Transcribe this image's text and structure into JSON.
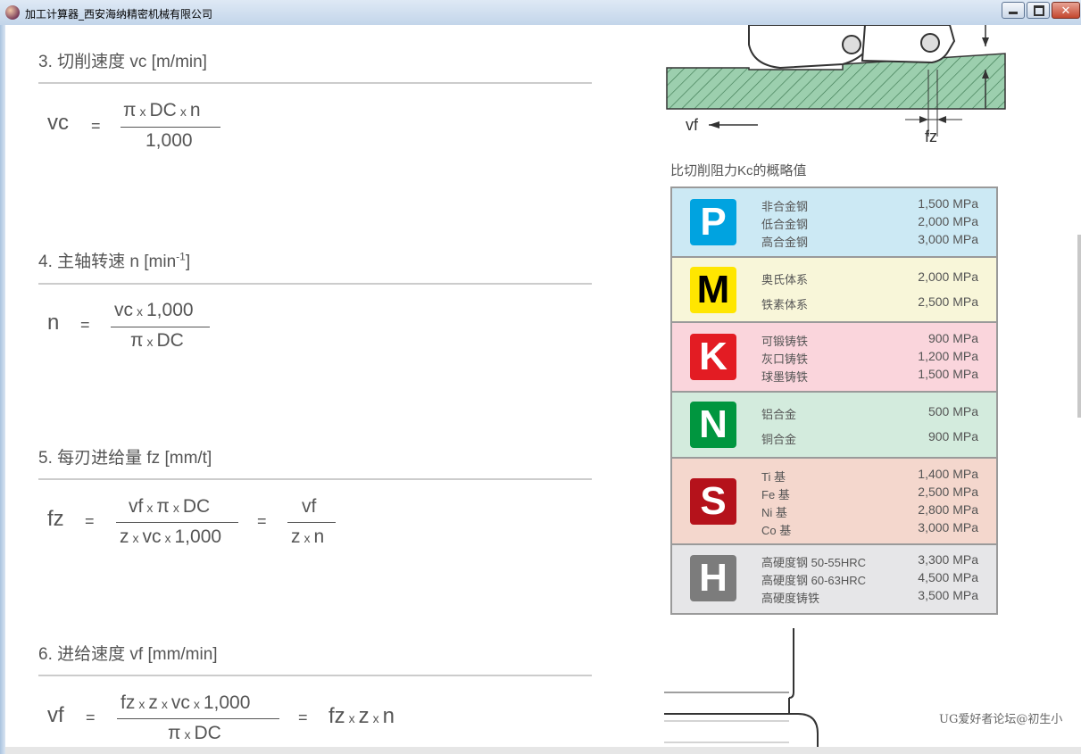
{
  "window": {
    "title": "加工计算器_西安海纳精密机械有限公司"
  },
  "sections": [
    {
      "title": "3. 切削速度 vc [m/min]",
      "var": "vc",
      "fractions": [
        {
          "num": [
            "π",
            "DC",
            "n"
          ],
          "den": [
            "1,000"
          ]
        }
      ]
    },
    {
      "title_main": "4. 主轴转速 n [min",
      "title_sup": "-1",
      "title_end": "]",
      "var": "n",
      "fractions": [
        {
          "num": [
            "vc",
            "1,000"
          ],
          "den": [
            "π",
            "DC"
          ]
        }
      ]
    },
    {
      "title": "5. 每刃进给量 fz [mm/t]",
      "var": "fz",
      "fractions": [
        {
          "num": [
            "vf",
            "π",
            "DC"
          ],
          "den": [
            "z",
            "vc",
            "1,000"
          ]
        },
        {
          "num": [
            "vf"
          ],
          "den": [
            "z",
            "n"
          ]
        }
      ]
    },
    {
      "title": "6. 进给速度 vf [mm/min]",
      "var": "vf",
      "fractions": [
        {
          "num": [
            "fz",
            "z",
            "vc",
            "1,000"
          ],
          "den": [
            "π",
            "DC"
          ]
        }
      ],
      "tail": [
        "fz",
        "z",
        "n"
      ]
    }
  ],
  "eq_sign": "=",
  "times": "x",
  "diagram": {
    "vf_label": "vf",
    "fz_label": "fz"
  },
  "kc_title": "比切削阻力Kc的概略值",
  "kc_table": [
    {
      "letter": "P",
      "bg": "#cce9f4",
      "badge_bg": "#00a3e0",
      "badge_fg": "#ffffff",
      "items": [
        {
          "material": "非合金钢",
          "value": "1,500 MPa"
        },
        {
          "material": "低合金钢",
          "value": "2,000 MPa"
        },
        {
          "material": "高合金钢",
          "value": "3,000 MPa"
        }
      ]
    },
    {
      "letter": "M",
      "bg": "#f8f6d9",
      "badge_bg": "#ffe600",
      "badge_fg": "#000000",
      "items": [
        {
          "material": "奥氏体系",
          "value": "2,000 MPa"
        },
        {
          "material": "铁素体系",
          "value": "2,500 MPa"
        }
      ]
    },
    {
      "letter": "K",
      "bg": "#fad5dc",
      "badge_bg": "#e31c23",
      "badge_fg": "#ffffff",
      "items": [
        {
          "material": "可锻铸铁",
          "value": "900 MPa"
        },
        {
          "material": "灰口铸铁",
          "value": "1,200 MPa"
        },
        {
          "material": "球墨铸铁",
          "value": "1,500 MPa"
        }
      ]
    },
    {
      "letter": "N",
      "bg": "#d3ebdd",
      "badge_bg": "#00963f",
      "badge_fg": "#ffffff",
      "items": [
        {
          "material": "铝合金",
          "value": "500 MPa"
        },
        {
          "material": "铜合金",
          "value": "900 MPa"
        }
      ]
    },
    {
      "letter": "S",
      "bg": "#f4d7cd",
      "badge_bg": "#b5121b",
      "badge_fg": "#ffffff",
      "items": [
        {
          "material": "Ti 基",
          "value": "1,400 MPa"
        },
        {
          "material": "Fe 基",
          "value": "2,500 MPa"
        },
        {
          "material": "Ni 基",
          "value": "2,800 MPa"
        },
        {
          "material": "Co 基",
          "value": "3,000 MPa"
        }
      ]
    },
    {
      "letter": "H",
      "bg": "#e6e6e8",
      "badge_bg": "#7c7c7c",
      "badge_fg": "#ffffff",
      "items": [
        {
          "material": "高硬度钢 50-55HRC",
          "value": "3,300 MPa"
        },
        {
          "material": "高硬度钢 60-63HRC",
          "value": "4,500 MPa"
        },
        {
          "material": "高硬度铸铁",
          "value": "3,500 MPa"
        }
      ]
    }
  ],
  "watermark": "UG爱好者论坛@初生小"
}
